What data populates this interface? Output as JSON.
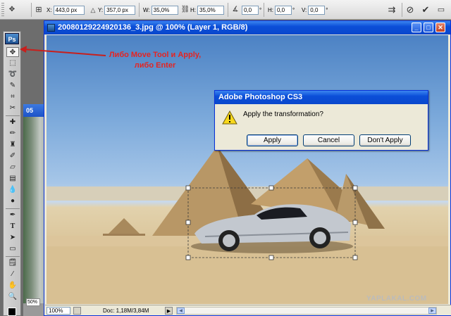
{
  "options_bar": {
    "x_label": "X:",
    "x_value": "443,0 px",
    "y_label": "Y:",
    "y_value": "357,0 px",
    "w_label": "W:",
    "w_value": "35,0%",
    "h_label": "H:",
    "h_value": "35,0%",
    "angle_value": "0,0",
    "hskew_label": "H:",
    "hskew_value": "0,0",
    "vskew_label": "V:",
    "vskew_value": "0,0",
    "icons": [
      "grip",
      "transform-reference-icon",
      "delta-icon",
      "link-icon",
      "angle-icon",
      "warp-icon",
      "cancel-icon",
      "commit-icon"
    ]
  },
  "tools_panel": {
    "logo": "Ps",
    "tools": [
      "move-tool",
      "marquee-tool",
      "lasso-tool",
      "magic-wand-tool",
      "crop-tool",
      "slice-tool",
      "healing-brush-tool",
      "brush-tool",
      "clone-stamp-tool",
      "history-brush-tool",
      "eraser-tool",
      "gradient-tool",
      "blur-tool",
      "dodge-tool",
      "pen-tool",
      "type-tool",
      "path-selection-tool",
      "shape-tool",
      "notes-tool",
      "eyedropper-tool",
      "hand-tool",
      "zoom-tool"
    ],
    "foreground_color": "#000000"
  },
  "background_document": {
    "title": "05",
    "zoom": "50%"
  },
  "document_window": {
    "title": "20080129224920136_3.jpg @ 100% (Layer 1, RGB/8)",
    "zoom": "100%",
    "doc_info": "Doc: 1,18M/3,84M"
  },
  "dialog": {
    "title": "Adobe Photoshop CS3",
    "message": "Apply the transformation?",
    "apply_label": "Apply",
    "cancel_label": "Cancel",
    "dont_apply_label": "Don't Apply"
  },
  "annotation": {
    "line1": "Либо Move Tool и Apply,",
    "line2": "либо Enter",
    "color": "#e52421"
  },
  "watermark": "YAPLAKAL.COM"
}
